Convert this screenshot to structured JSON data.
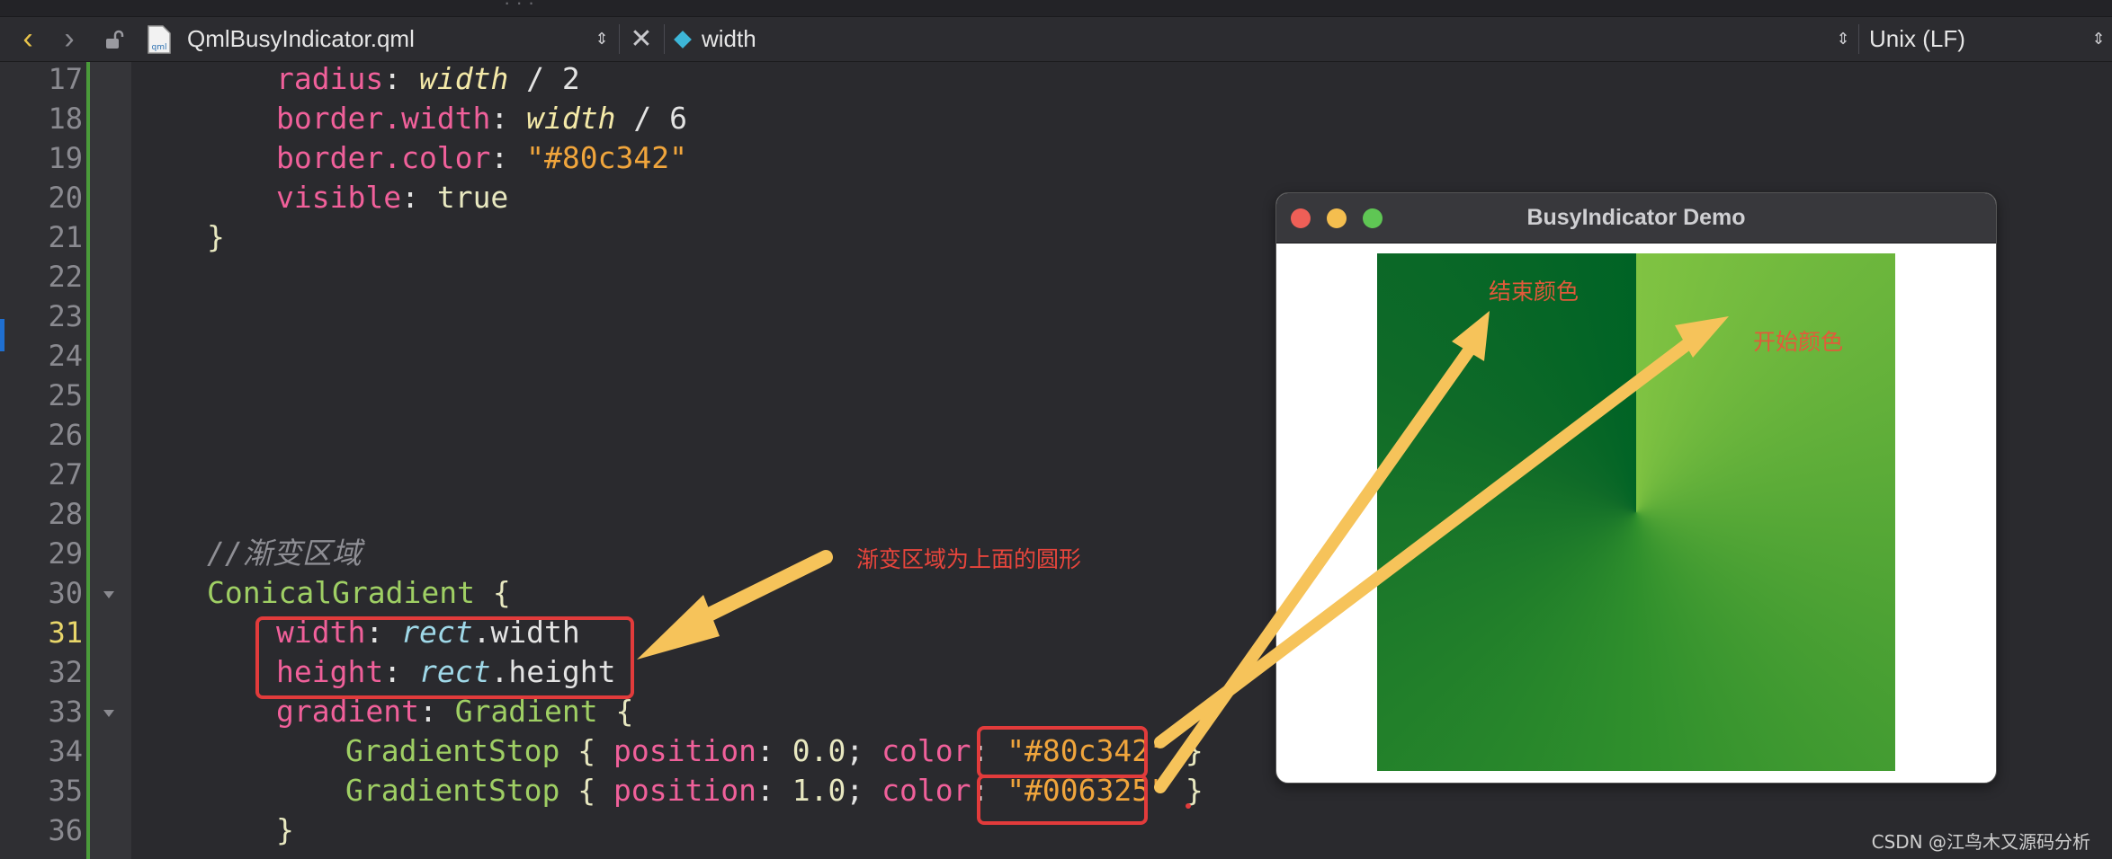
{
  "toolbar": {
    "filename": "QmlBusyIndicator.qml",
    "file_icon_label": "qml",
    "symbol": "width",
    "line_ending": "Unix (LF)"
  },
  "line_numbers": [
    "17",
    "18",
    "19",
    "20",
    "21",
    "22",
    "23",
    "24",
    "25",
    "26",
    "27",
    "28",
    "29",
    "30",
    "31",
    "32",
    "33",
    "34",
    "35",
    "36"
  ],
  "code": {
    "l17": {
      "k": "radius",
      "v": "width",
      "rest": " / 2"
    },
    "l18": {
      "k": "border.width",
      "v": "width",
      "rest": " / 6"
    },
    "l19": {
      "k": "border.color",
      "s": "\"#80c342\""
    },
    "l20": {
      "k": "visible",
      "v": "true"
    },
    "l21": "}",
    "l29": "//渐变区域",
    "l30": {
      "t": "ConicalGradient",
      "b": " {"
    },
    "l31": {
      "k": "width",
      "o": "rect",
      "p": ".width"
    },
    "l32": {
      "k": "height",
      "o": "rect",
      "p": ".height"
    },
    "l33": {
      "k": "gradient",
      "t": "Gradient",
      "b": " {"
    },
    "l34": {
      "t": "GradientStop",
      "pk": "position",
      "pv": "0.0",
      "ck": "color",
      "s": "\"#80c342\"",
      "e": " }"
    },
    "l35": {
      "t": "GradientStop",
      "pk": "position",
      "pv": "1.0",
      "ck": "color",
      "s": "\"#006325\"",
      "e": " }"
    },
    "l36": "}"
  },
  "annotations": {
    "region": "渐变区域为上面的圆形",
    "end_color": "结束颜色",
    "start_color": "开始颜色"
  },
  "demo_window": {
    "title": "BusyIndicator Demo",
    "gradient_start": "#80c342",
    "gradient_end": "#006325"
  },
  "watermark": "CSDN @江鸟木又源码分析"
}
